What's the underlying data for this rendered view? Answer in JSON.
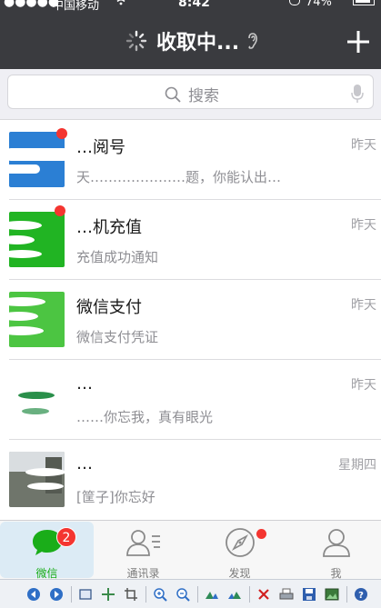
{
  "status_bar": {
    "signal_dots": "●●●●●",
    "carrier": "中国移动",
    "time": "8:42",
    "battery": "74%"
  },
  "nav": {
    "title": "收取中...",
    "add_icon": "plus-icon",
    "title_icon": "spinner-icon"
  },
  "search": {
    "placeholder": "搜索",
    "icon": "search-icon",
    "voice_icon": "mic-icon"
  },
  "chats": [
    {
      "name": "…阅号",
      "message": "天…………………题，你能认出…",
      "time": "昨天",
      "unread_dot": true,
      "avatar_color": "#2b7fd4"
    },
    {
      "name": "…机充值",
      "message": "充值成功通知",
      "time": "昨天",
      "unread_dot": true,
      "avatar_color": "#21b423"
    },
    {
      "name": "微信支付",
      "message": "微信支付凭证",
      "time": "昨天",
      "unread_dot": false,
      "avatar_color": "#4cc542"
    },
    {
      "name": "…",
      "message": "……你忘我，真有眼光",
      "time": "昨天",
      "unread_dot": false,
      "avatar_color": "#2a8f4a"
    },
    {
      "name": "…",
      "message": "[筐子]你忘好",
      "time": "星期四",
      "unread_dot": false,
      "avatar_color": "#8a8f85"
    }
  ],
  "tabs": [
    {
      "label": "微信",
      "icon": "chat-bubble-icon",
      "badge": "2",
      "active": true
    },
    {
      "label": "通讯录",
      "icon": "contacts-icon",
      "badge": "",
      "active": false
    },
    {
      "label": "发现",
      "icon": "compass-icon",
      "badge": "",
      "active": false
    },
    {
      "label": "我",
      "icon": "person-icon",
      "badge": "",
      "active": false
    }
  ],
  "colors": {
    "nav_bg": "#3a3b3f",
    "wechat_green": "#1aad19",
    "badge_red": "#f43530",
    "active_tab_bg": "#dcebf5"
  },
  "viewer_toolbar": {
    "buttons": [
      "prev-icon",
      "next-icon",
      "fit-icon",
      "move-icon",
      "crop-icon",
      "zoom-in-icon",
      "zoom-out-icon",
      "rotate-left-icon",
      "rotate-right-icon",
      "delete-icon",
      "print-icon",
      "save-icon",
      "wallpaper-icon",
      "help-icon"
    ]
  }
}
